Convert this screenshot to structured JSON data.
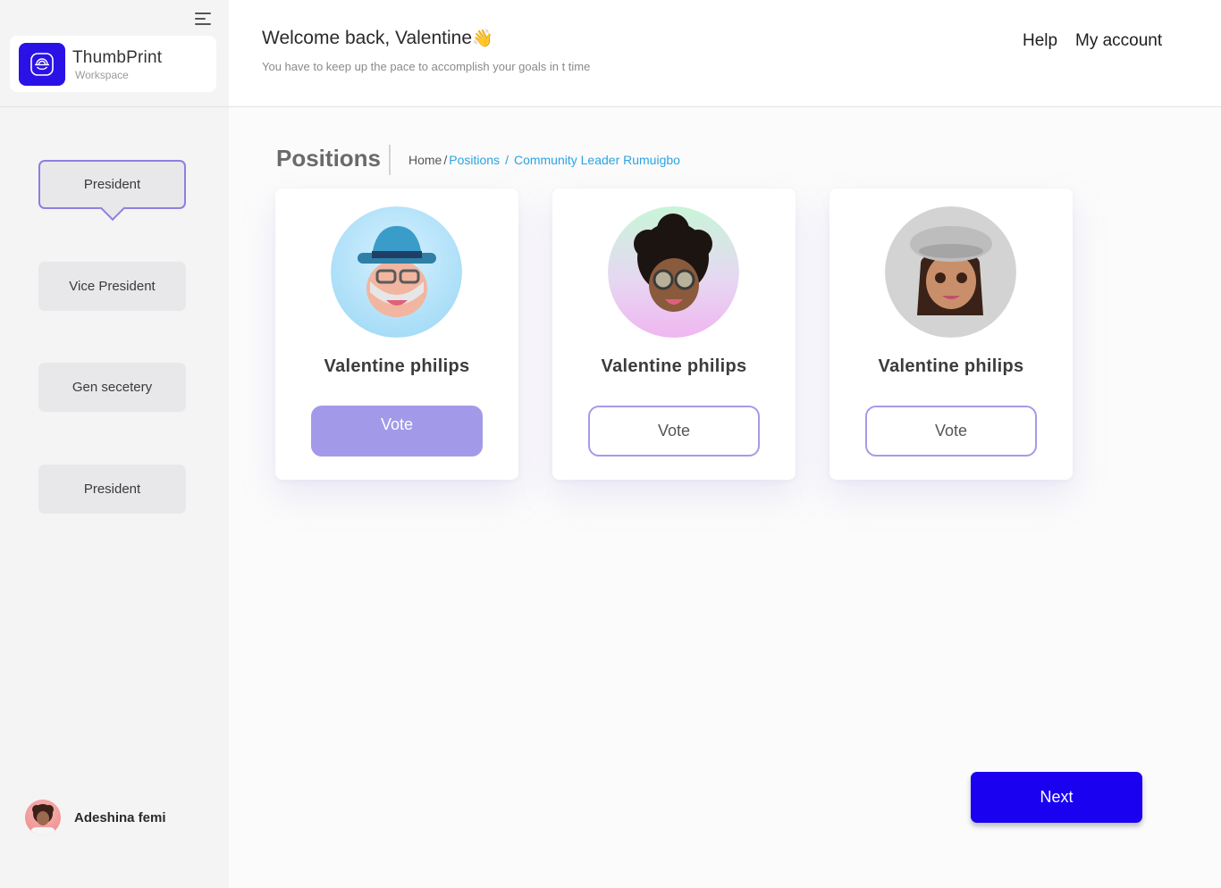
{
  "brand": {
    "title": "ThumbPrint",
    "subtitle": "Workspace",
    "icon": "fingerprint-scan-icon",
    "color": "#2a12e6"
  },
  "header": {
    "welcome": "Welcome back, Valentine",
    "wave_emoji": "👋",
    "subtitle": "You have to keep up the pace to accomplish your goals in t time",
    "help": "Help",
    "account": "My account"
  },
  "sidebar": {
    "positions": [
      {
        "label": "President",
        "active": true
      },
      {
        "label": "Vice President",
        "active": false
      },
      {
        "label": "Gen secetery",
        "active": false
      },
      {
        "label": "President",
        "active": false
      }
    ],
    "user": {
      "name": "Adeshina femi"
    }
  },
  "main": {
    "title": "Positions",
    "breadcrumb": {
      "home": "Home",
      "sep": "/",
      "positions": "Positions",
      "current": "Community Leader Rumuigbo"
    },
    "candidates": [
      {
        "name": "Valentine philips",
        "vote_label": "Vote",
        "selected": true,
        "avatar": "man-with-blue-hat-avatar"
      },
      {
        "name": "Valentine philips",
        "vote_label": "Vote",
        "selected": false,
        "avatar": "curly-hair-sunglasses-avatar"
      },
      {
        "name": "Valentine philips",
        "vote_label": "Vote",
        "selected": false,
        "avatar": "woman-with-beret-avatar"
      }
    ],
    "next_label": "Next"
  },
  "colors": {
    "accent": "#1a02f0",
    "vote_selected": "#a29ae9",
    "vote_border": "#a49be8",
    "link": "#2ba3e3"
  }
}
